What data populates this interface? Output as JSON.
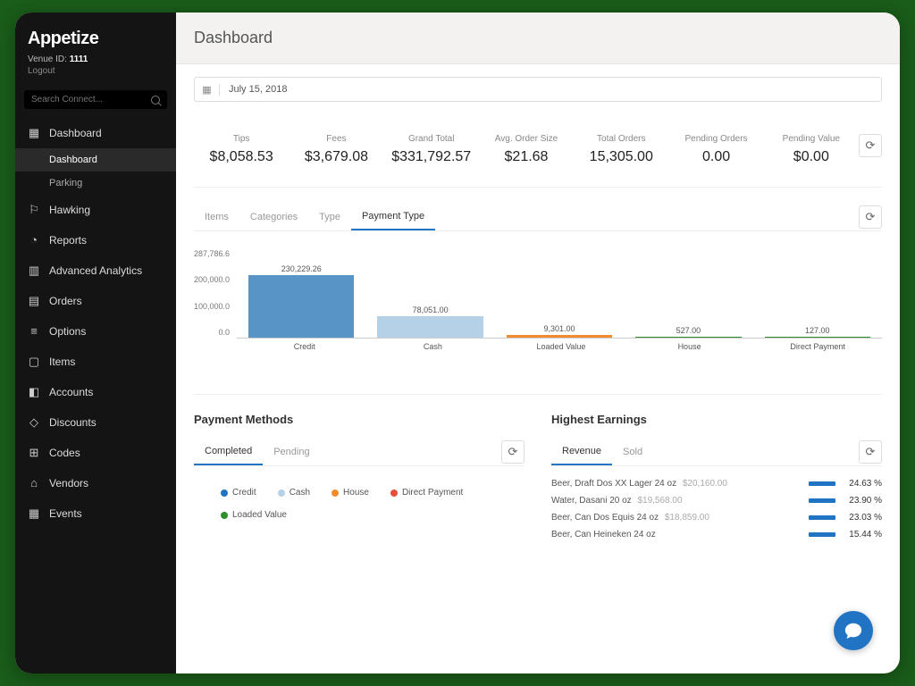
{
  "brand": "Appetize",
  "venue_label": "Venue ID:",
  "venue_id": "1111",
  "logout": "Logout",
  "search_placeholder": "Search Connect...",
  "nav": [
    {
      "label": "Dashboard",
      "icon": "▦",
      "sub": [
        {
          "label": "Dashboard",
          "active": true
        },
        {
          "label": "Parking"
        }
      ]
    },
    {
      "label": "Hawking",
      "icon": "⚐"
    },
    {
      "label": "Reports",
      "icon": "◔"
    },
    {
      "label": "Advanced Analytics",
      "icon": "▥"
    },
    {
      "label": "Orders",
      "icon": "▤"
    },
    {
      "label": "Options",
      "icon": "≡"
    },
    {
      "label": "Items",
      "icon": "▢"
    },
    {
      "label": "Accounts",
      "icon": "◧"
    },
    {
      "label": "Discounts",
      "icon": "◇"
    },
    {
      "label": "Codes",
      "icon": "⊞"
    },
    {
      "label": "Vendors",
      "icon": "⌂"
    },
    {
      "label": "Events",
      "icon": "▦"
    }
  ],
  "page_title": "Dashboard",
  "date": "July 15, 2018",
  "kpis": [
    {
      "label": "Tips",
      "value": "$8,058.53"
    },
    {
      "label": "Fees",
      "value": "$3,679.08"
    },
    {
      "label": "Grand Total",
      "value": "$331,792.57"
    },
    {
      "label": "Avg. Order Size",
      "value": "$21.68"
    },
    {
      "label": "Total Orders",
      "value": "15,305.00"
    },
    {
      "label": "Pending Orders",
      "value": "0.00"
    },
    {
      "label": "Pending Value",
      "value": "$0.00"
    }
  ],
  "chart_tabs": [
    "Items",
    "Categories",
    "Type",
    "Payment Type"
  ],
  "chart_tab_active": 3,
  "chart_data": {
    "type": "bar",
    "title": "",
    "xlabel": "",
    "ylabel": "",
    "ylim": [
      0,
      287786.6
    ],
    "yticks": [
      "287,786.6",
      "200,000.0",
      "100,000.0",
      "0.0"
    ],
    "categories": [
      "Credit",
      "Cash",
      "Loaded Value",
      "House",
      "Direct Payment"
    ],
    "values": [
      230229.26,
      78051.0,
      9301.0,
      527.0,
      127.0
    ],
    "value_labels": [
      "230,229.26",
      "78,051.00",
      "9,301.00",
      "527.00",
      "127.00"
    ],
    "colors": [
      "#5994c6",
      "#b5d1e8",
      "#f08c2e",
      "#2d8f2d",
      "#2d8f2d"
    ]
  },
  "payment_methods": {
    "title": "Payment Methods",
    "tabs": [
      "Completed",
      "Pending"
    ],
    "active": 0,
    "legend": [
      {
        "name": "Credit",
        "color": "#2173c4"
      },
      {
        "name": "Cash",
        "color": "#b5d1e8"
      },
      {
        "name": "House",
        "color": "#f08c2e"
      },
      {
        "name": "Direct Payment",
        "color": "#e94e3a"
      },
      {
        "name": "Loaded Value",
        "color": "#2d8f2d"
      }
    ]
  },
  "highest_earnings": {
    "title": "Highest Earnings",
    "tabs": [
      "Revenue",
      "Sold"
    ],
    "active": 0,
    "rows": [
      {
        "name": "Beer, Draft Dos XX Lager 24 oz",
        "amount": "$20,160.00",
        "pct": "24.63 %"
      },
      {
        "name": "Water, Dasani 20 oz",
        "amount": "$19,568.00",
        "pct": "23.90 %"
      },
      {
        "name": "Beer, Can Dos Equis 24 oz",
        "amount": "$18,859.00",
        "pct": "23.03 %"
      },
      {
        "name": "Beer, Can Heineken 24 oz",
        "amount": "",
        "pct": "15.44 %"
      }
    ]
  }
}
